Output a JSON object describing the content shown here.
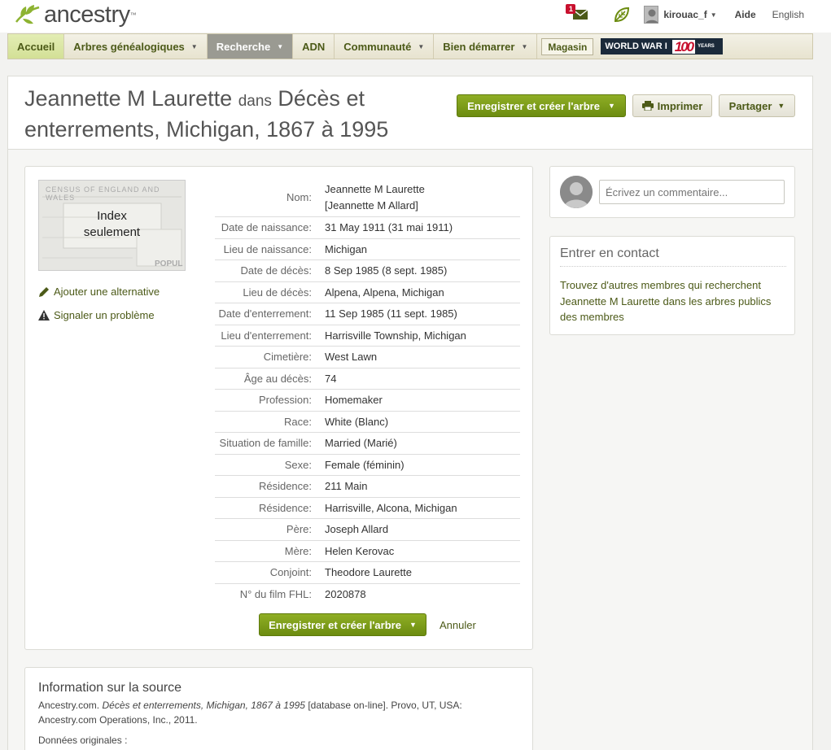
{
  "topbar": {
    "logo_text": "ancestry",
    "mail_count": "1",
    "username": "kirouac_f",
    "help": "Aide",
    "language": "English"
  },
  "nav": {
    "items": [
      {
        "label": "Accueil"
      },
      {
        "label": "Arbres généalogiques"
      },
      {
        "label": "Recherche"
      },
      {
        "label": "ADN"
      },
      {
        "label": "Communauté"
      },
      {
        "label": "Bien démarrer"
      }
    ],
    "store": "Magasin",
    "ww1_text": "WORLD WAR I",
    "ww1_number": "100",
    "ww1_years": "YEARS"
  },
  "header": {
    "name": "Jeannette M Laurette",
    "connector": "dans",
    "collection": "Décès et enterrements, Michigan, 1867 à 1995",
    "save_button": "Enregistrer et créer l'arbre",
    "print_button": "Imprimer",
    "share_button": "Partager"
  },
  "record": {
    "thumb_label_1": "Index",
    "thumb_label_2": "seulement",
    "thumb_bg_1": "CENSUS OF ENGLAND AND WALES",
    "thumb_bg_2": "POPUL",
    "add_alt": "Ajouter une alternative",
    "report": "Signaler un problème",
    "fields": [
      {
        "label": "Nom:",
        "value": "Jeannette M Laurette",
        "value2": "[Jeannette M Allard]"
      },
      {
        "label": "Date de naissance:",
        "value": "31 May 1911 (31 mai 1911)"
      },
      {
        "label": "Lieu de naissance:",
        "value": "Michigan"
      },
      {
        "label": "Date de décès:",
        "value": "8 Sep 1985 (8 sept. 1985)"
      },
      {
        "label": "Lieu de décès:",
        "value": "Alpena, Alpena, Michigan"
      },
      {
        "label": "Date d'enterrement:",
        "value": "11 Sep 1985 (11 sept. 1985)"
      },
      {
        "label": "Lieu d'enterrement:",
        "value": "Harrisville Township, Michigan"
      },
      {
        "label": "Cimetière:",
        "value": "West Lawn"
      },
      {
        "label": "Âge au décès:",
        "value": "74"
      },
      {
        "label": "Profession:",
        "value": "Homemaker"
      },
      {
        "label": "Race:",
        "value": "White (Blanc)"
      },
      {
        "label": "Situation de famille:",
        "value": "Married (Marié)"
      },
      {
        "label": "Sexe:",
        "value": "Female (féminin)"
      },
      {
        "label": "Résidence:",
        "value": "211 Main"
      },
      {
        "label": "Résidence:",
        "value": "Harrisville, Alcona, Michigan"
      },
      {
        "label": "Père:",
        "value": "Joseph Allard"
      },
      {
        "label": "Mère:",
        "value": "Helen Kerovac"
      },
      {
        "label": "Conjoint:",
        "value": "Theodore Laurette"
      },
      {
        "label": "N° du film FHL:",
        "value": "2020878"
      }
    ],
    "save_button": "Enregistrer et créer l'arbre",
    "cancel": "Annuler"
  },
  "comment": {
    "placeholder": "Écrivez un commentaire..."
  },
  "contact": {
    "title": "Entrer en contact",
    "text": "Trouvez d'autres membres qui recherchent Jeannette M Laurette dans les arbres publics des membres"
  },
  "source": {
    "title": "Information sur la source",
    "publisher": "Ancestry.com.",
    "db_title": "Décès et enterrements, Michigan, 1867 à 1995",
    "rest": "[database on-line]. Provo, UT, USA: Ancestry.com Operations, Inc., 2011.",
    "original": "Données originales :"
  },
  "colors": {
    "accent_green": "#6c8c10",
    "link_green": "#4c5a18",
    "badge_red": "#c8102e"
  }
}
